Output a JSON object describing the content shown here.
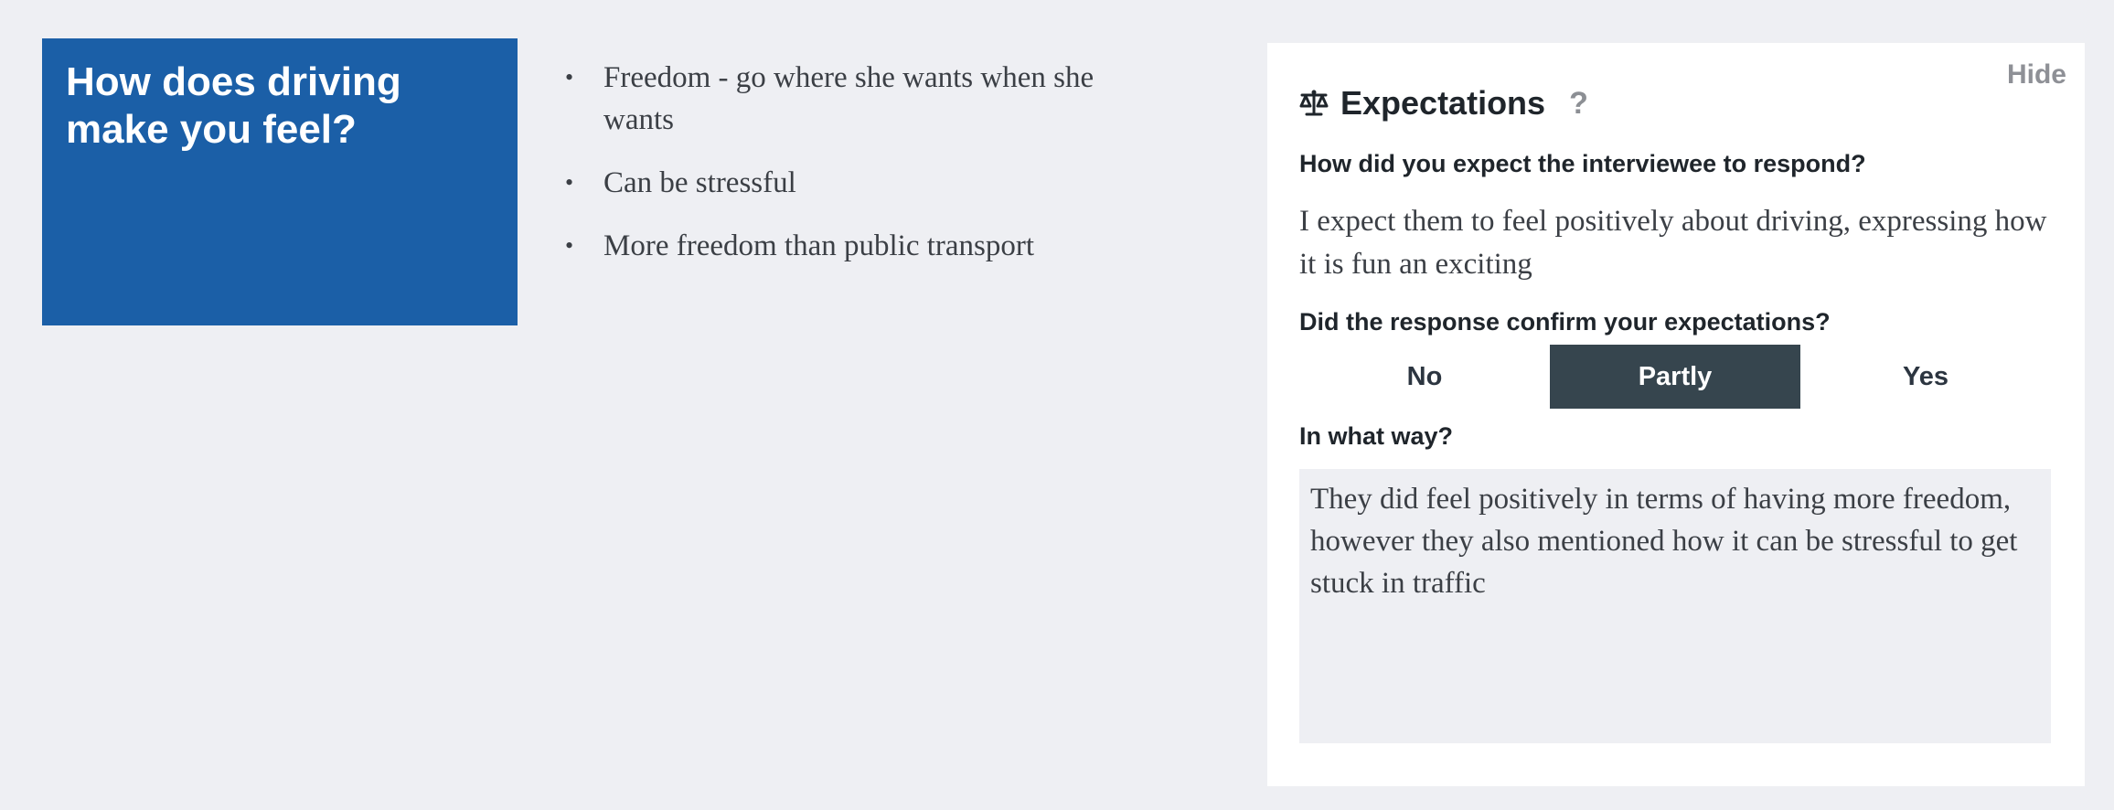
{
  "question_card": {
    "title": "How does driving make you feel?",
    "color": "#1b5fa7"
  },
  "notes": {
    "items": [
      "Freedom - go where she wants when she wants",
      "Can be stressful",
      "More freedom than public transport"
    ]
  },
  "expectations_panel": {
    "hide_label": "Hide",
    "icon": "scales-icon",
    "title": "Expectations",
    "help_label": "?",
    "expect_question": "How did you expect the interviewee to respond?",
    "expect_answer": "I expect them to feel positively about driving, expressing how it is fun an exciting",
    "confirm_question": "Did the response confirm your expectations?",
    "options": [
      "No",
      "Partly",
      "Yes"
    ],
    "selected_option": "Partly",
    "selected_color": "#36454e",
    "way_question": "In what way?",
    "way_answer": "They did feel positively in terms of having more freedom, however they also mentioned how it can be stressful to get stuck in traffic"
  }
}
